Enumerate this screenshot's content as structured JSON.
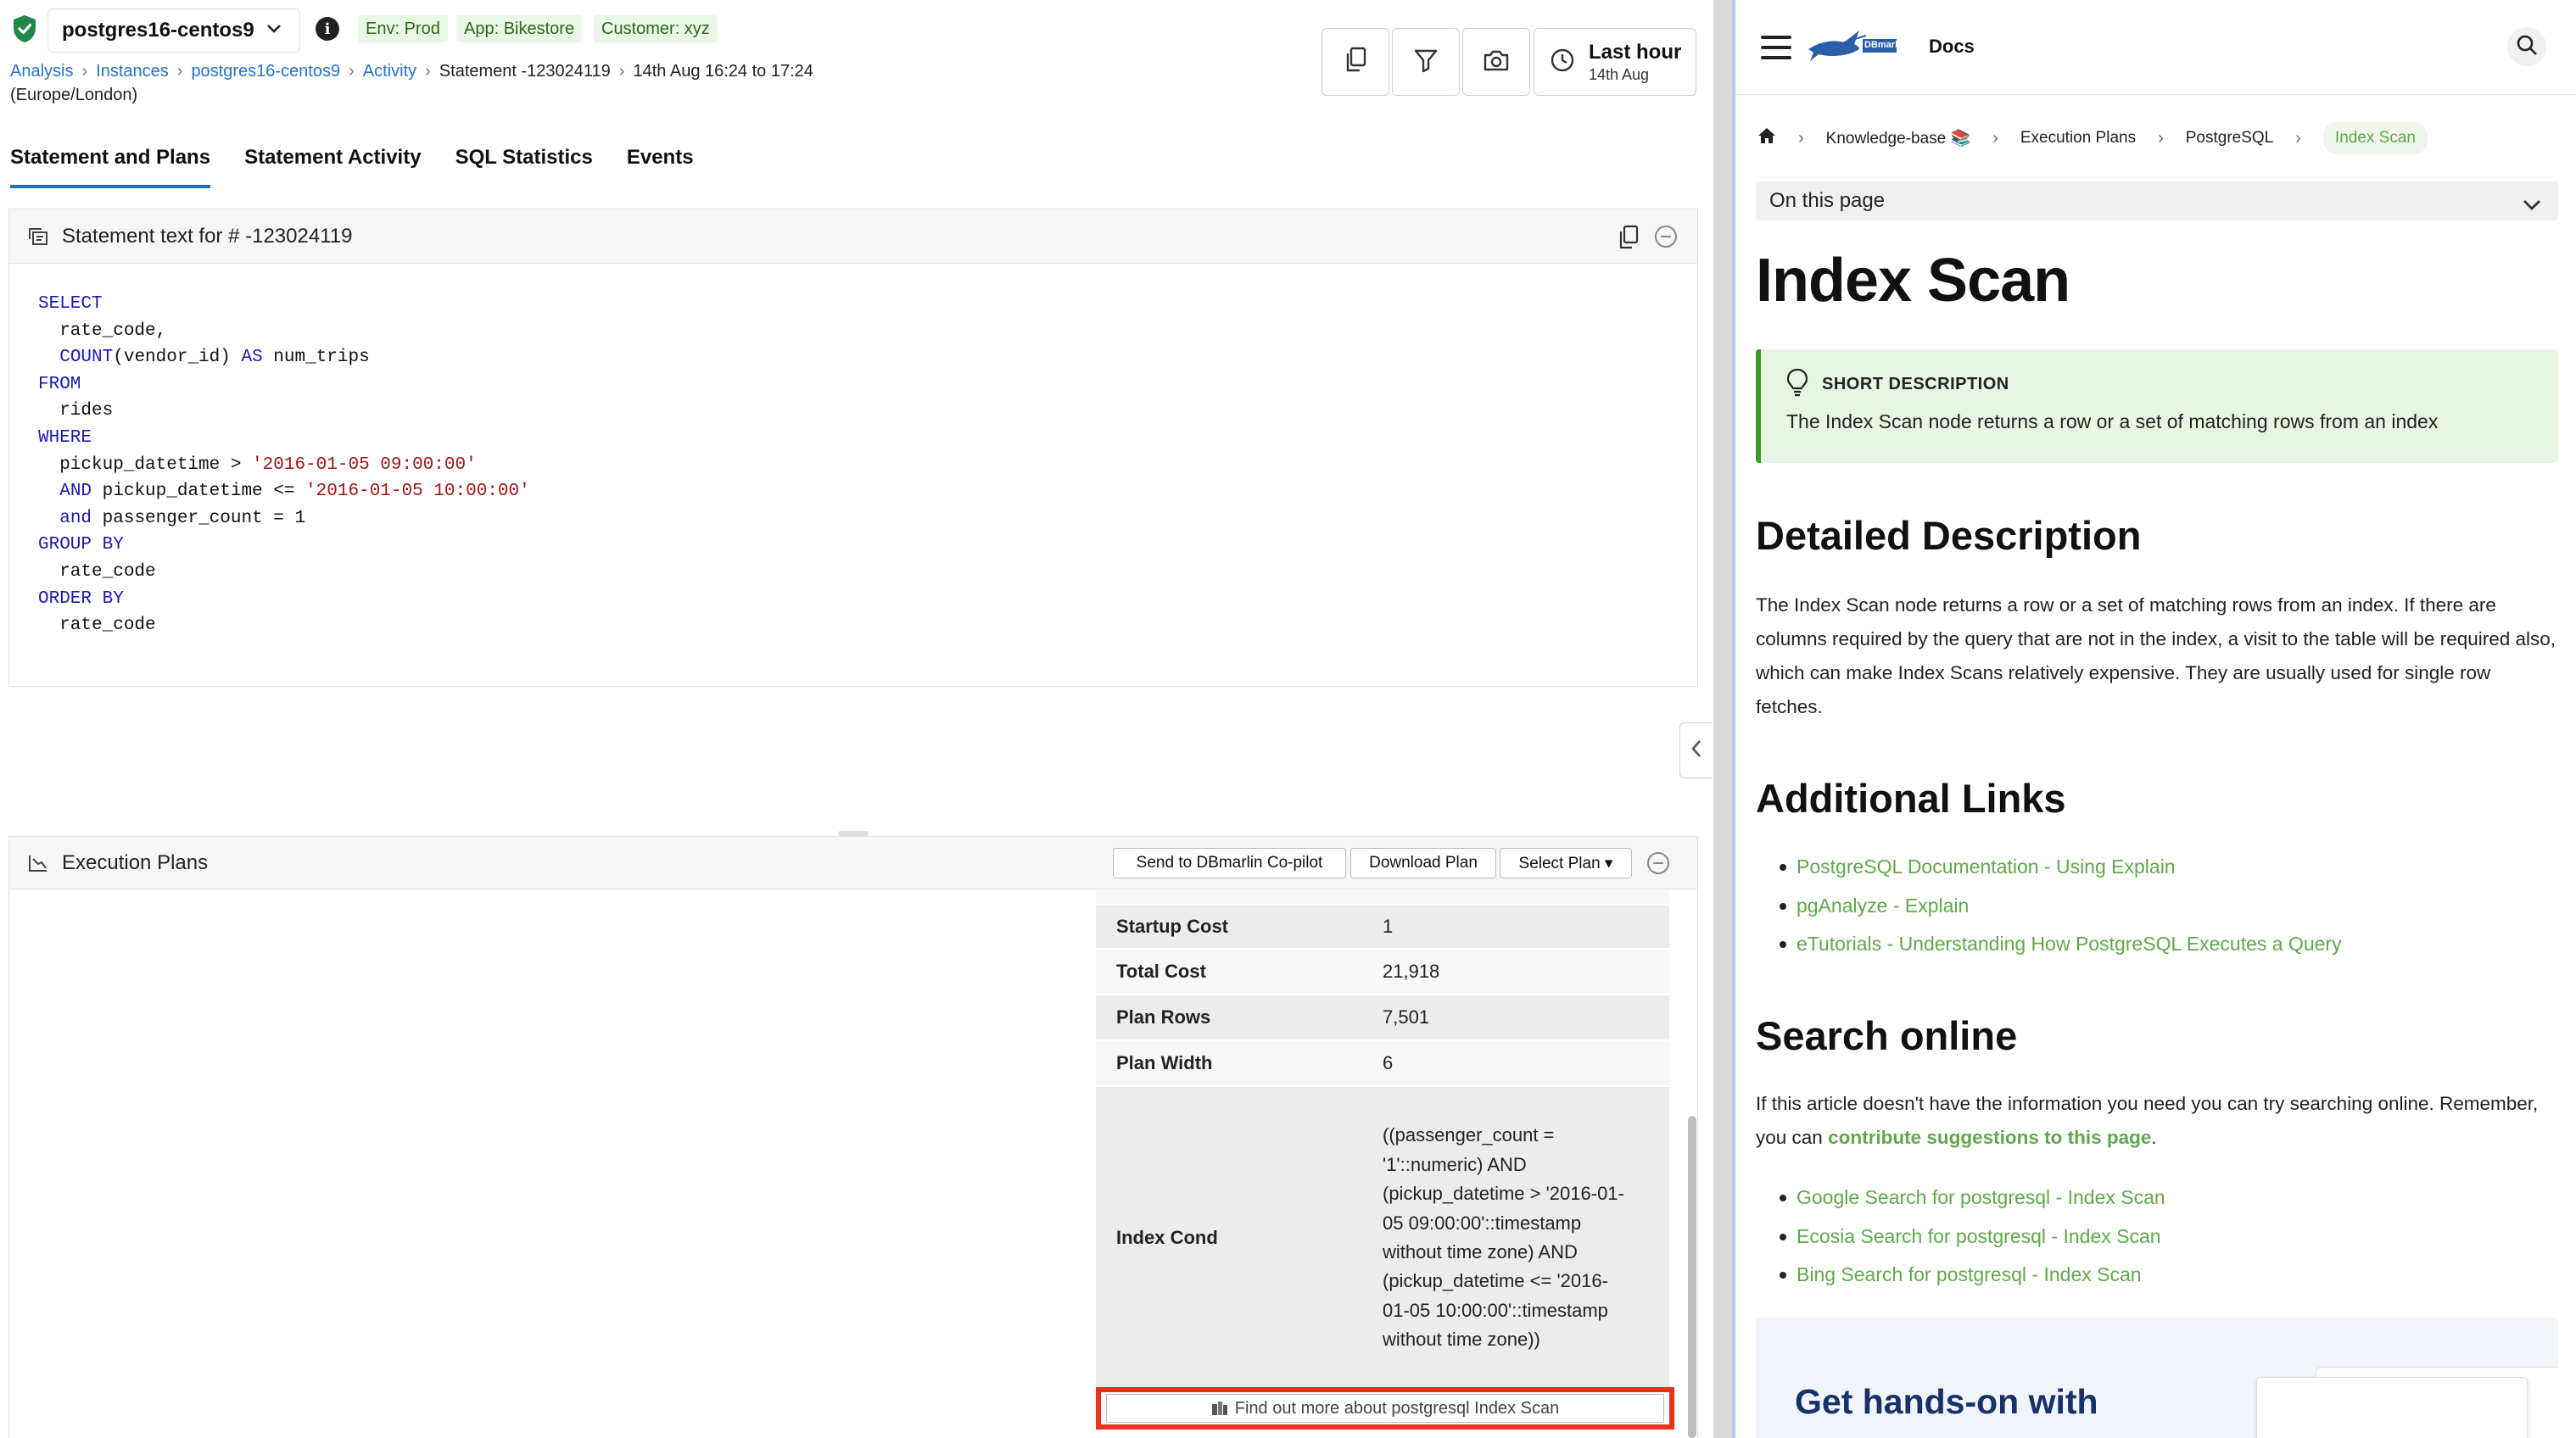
{
  "header": {
    "instance": "postgres16-centos9",
    "tags": [
      "Env: Prod",
      "App: Bikestore",
      "Customer: xyz"
    ]
  },
  "breadcrumb": {
    "links": [
      "Analysis",
      "Instances",
      "postgres16-centos9",
      "Activity"
    ],
    "statement": "Statement -123024119",
    "range": "14th Aug 16:24 to 17:24",
    "timezone": "(Europe/London)"
  },
  "toolbar": {
    "icons": [
      "copy-icon",
      "filter-icon",
      "camera-icon",
      "clock-icon"
    ],
    "time_label": "Last hour",
    "time_date": "14th Aug"
  },
  "tabs": [
    "Statement and Plans",
    "Statement Activity",
    "SQL Statistics",
    "Events"
  ],
  "statement_panel": {
    "title": "Statement text for # -123024119",
    "sql": [
      [
        [
          "kw",
          "SELECT"
        ]
      ],
      [
        [
          "t",
          "  rate_code,"
        ]
      ],
      [
        [
          "t",
          "  "
        ],
        [
          "kw",
          "COUNT"
        ],
        [
          "t",
          "(vendor_id) "
        ],
        [
          "kw",
          "AS"
        ],
        [
          "t",
          " num_trips"
        ]
      ],
      [
        [
          "kw",
          "FROM"
        ]
      ],
      [
        [
          "t",
          "  rides"
        ]
      ],
      [
        [
          "kw",
          "WHERE"
        ]
      ],
      [
        [
          "t",
          "  pickup_datetime > "
        ],
        [
          "str",
          "'2016-01-05 09:00:00'"
        ]
      ],
      [
        [
          "t",
          "  "
        ],
        [
          "kw",
          "AND"
        ],
        [
          "t",
          " pickup_datetime <= "
        ],
        [
          "str",
          "'2016-01-05 10:00:00'"
        ]
      ],
      [
        [
          "t",
          "  "
        ],
        [
          "kw",
          "and"
        ],
        [
          "t",
          " passenger_count = 1"
        ]
      ],
      [
        [
          "kw",
          "GROUP BY"
        ]
      ],
      [
        [
          "t",
          "  rate_code"
        ]
      ],
      [
        [
          "kw",
          "ORDER BY"
        ]
      ],
      [
        [
          "t",
          "  rate_code"
        ]
      ]
    ]
  },
  "plans_panel": {
    "title": "Execution Plans",
    "send_label": "Send to DBmarlin Co-pilot",
    "download_label": "Download Plan",
    "select_label": "Select Plan ▾",
    "properties": [
      {
        "key": "Startup Cost",
        "value": "1"
      },
      {
        "key": "Total Cost",
        "value": "21,918"
      },
      {
        "key": "Plan Rows",
        "value": "7,501"
      },
      {
        "key": "Plan Width",
        "value": "6"
      },
      {
        "key": "Index Cond",
        "value": "((passenger_count = '1'::numeric) AND (pickup_datetime > '2016-01-05 09:00:00'::timestamp without time zone) AND (pickup_datetime <= '2016-01-05 10:00:00'::timestamp without time zone))"
      }
    ],
    "find_out_label": "Find out more about postgresql Index Scan"
  },
  "docs": {
    "brand": "DBmarlin",
    "docs_label": "Docs",
    "breadcrumb": [
      "Knowledge-base 📚",
      "Execution Plans",
      "PostgreSQL",
      "Index Scan"
    ],
    "on_this_page": "On this page",
    "title": "Index Scan",
    "short_desc_title": "SHORT DESCRIPTION",
    "short_desc": "The Index Scan node returns a row or a set of matching rows from an index",
    "detailed_heading": "Detailed Description",
    "detailed_text": "The Index Scan node returns a row or a set of matching rows from an index. If there are columns required by the query that are not in the index, a visit to the table will be required also, which can make Index Scans relatively expensive. They are usually used for single row fetches.",
    "links_heading": "Additional Links",
    "links": [
      "PostgreSQL Documentation - Using Explain",
      "pgAnalyze - Explain",
      "eTutorials - Understanding How PostgreSQL Executes a Query"
    ],
    "search_heading": "Search online",
    "search_text_1": "If this article doesn't have the information you need you can try searching online. Remember, you can",
    "search_link": "contribute suggestions to this page",
    "search_text_2": ".",
    "search_links": [
      "Google Search for postgresql - Index Scan",
      "Ecosia Search for postgresql - Index Scan",
      "Bing Search for postgresql - Index Scan"
    ],
    "promo_title": "Get hands-on  with"
  },
  "colors": {
    "link": "#2573c8",
    "accent_green": "#5fa84a",
    "highlight": "#e8321a"
  }
}
